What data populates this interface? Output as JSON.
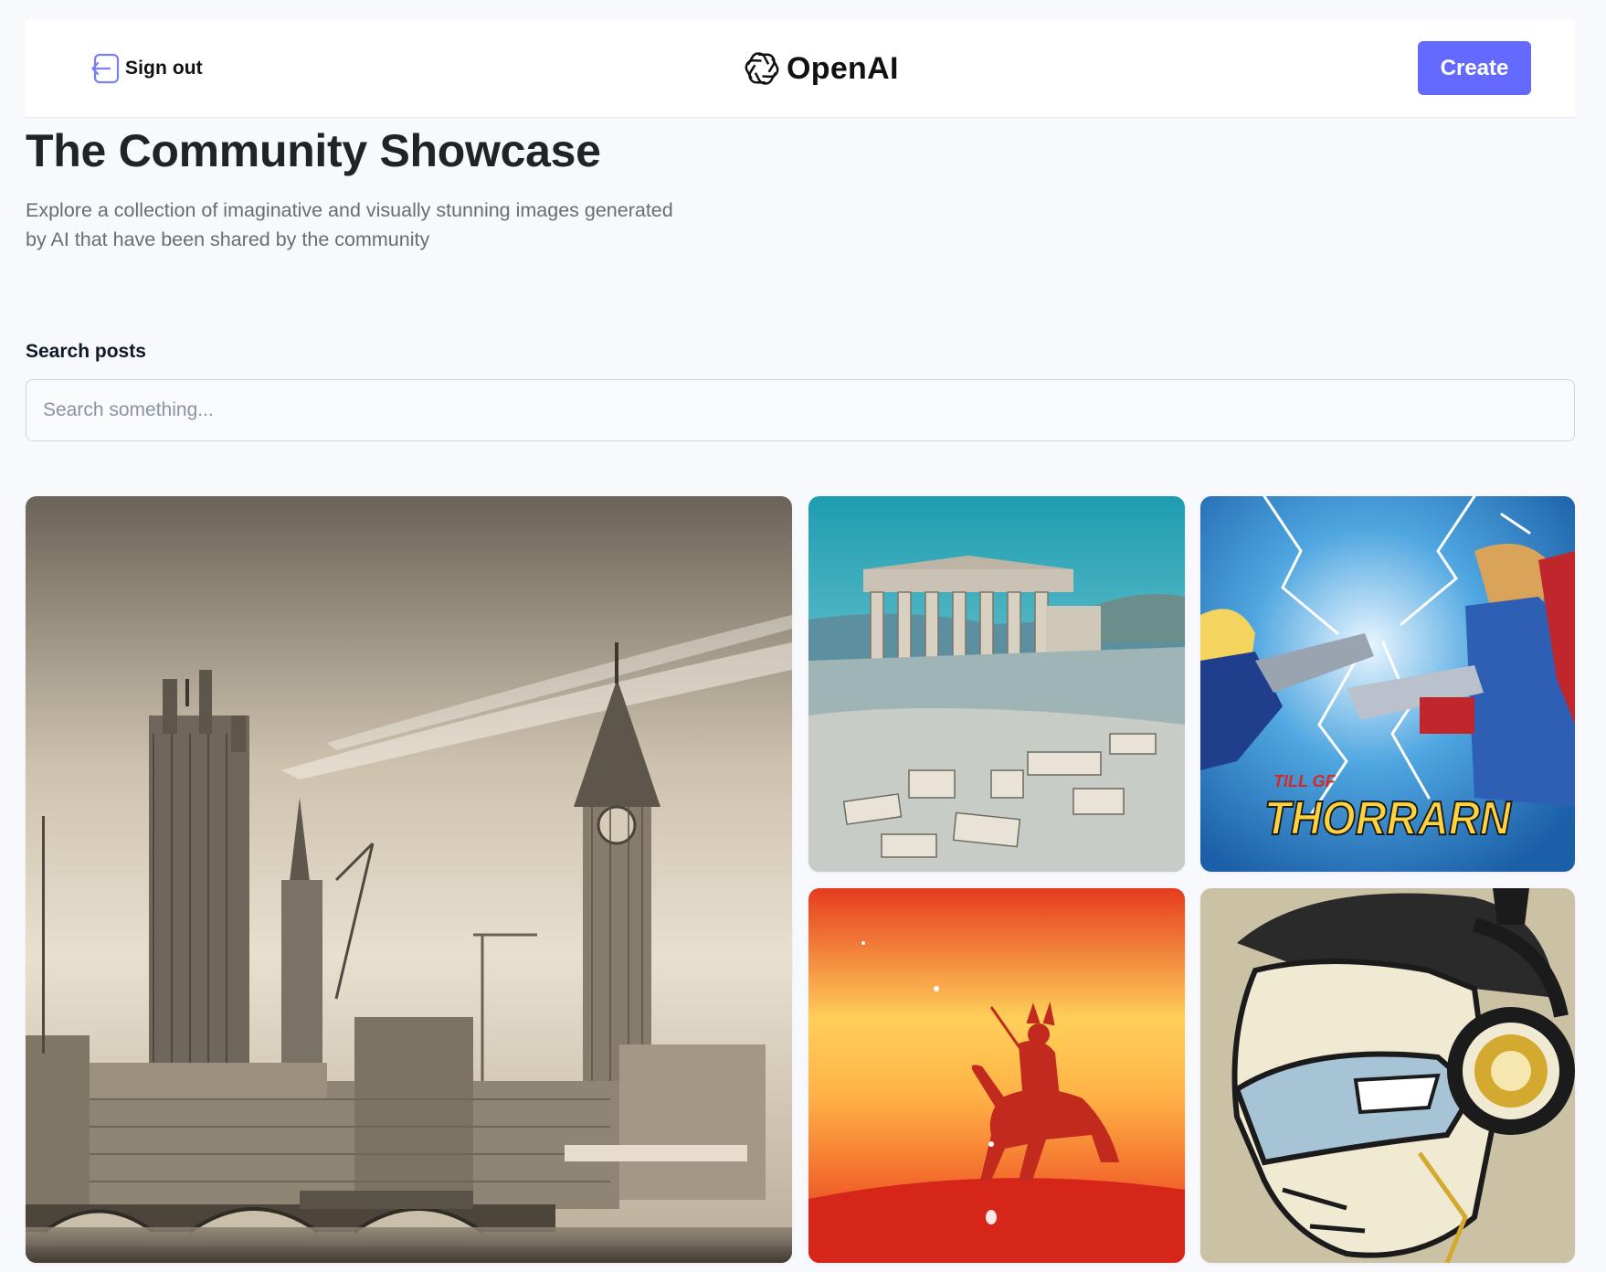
{
  "header": {
    "signout_label": "Sign out",
    "signout_icon": "sign-out-icon",
    "logo_text": "OpenAI",
    "logo_icon": "openai-logo-icon",
    "create_label": "Create",
    "accent_color": "#6469ff"
  },
  "main": {
    "title": "The Community Showcase",
    "subtitle_line1": "Explore a collection of imaginative and visually stunning images generated",
    "subtitle_line2": "by AI that have been shared by the community"
  },
  "search": {
    "label": "Search posts",
    "placeholder": "Search something...",
    "value": ""
  },
  "gallery": {
    "cards": [
      {
        "subject": "sepia London skyline with Big Ben and Thames bridge"
      },
      {
        "subject": "Greek temple ruins on a rocky hill by the sea"
      },
      {
        "subject": "comic book heroes clashing with lightning",
        "caption_top": "TILL GF",
        "caption_main": "THORRARN"
      },
      {
        "subject": "red silhouette of a samurai on horseback"
      },
      {
        "subject": "comic style masked hero wearing headphones"
      }
    ]
  }
}
